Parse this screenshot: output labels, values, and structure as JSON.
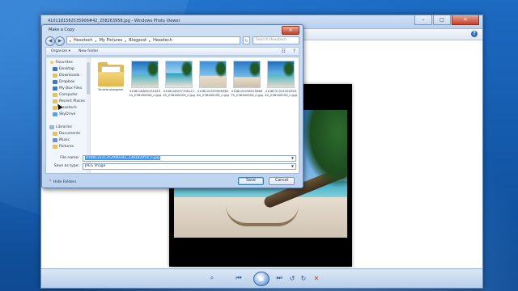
{
  "viewer": {
    "title": "4101181562535906#42_258263958.jpg - Windows Photo Viewer",
    "controls": {
      "zoom": "⌕",
      "previous": "⏮",
      "slideshow": "▣",
      "next": "⏭",
      "rotate_left": "↺",
      "rotate_right": "↻",
      "delete": "✕"
    }
  },
  "dialog": {
    "title": "Make a Copy",
    "breadcrumbs": [
      "Hexotech",
      "My Pictures",
      "Blogpost",
      "Hexotech"
    ],
    "search_placeholder": "Search Hexotech",
    "toolbar": {
      "organize": "Organize ▾",
      "new_folder": "New folder"
    },
    "nav": {
      "favorites_header": "Favorites",
      "favorites": [
        "Desktop",
        "Downloads",
        "Dropbox",
        "My Box Files",
        "Computer",
        "Recent Places",
        "Hexotech",
        "SkyDrive"
      ],
      "libraries_header": "Libraries",
      "libraries": [
        "Documents",
        "Music",
        "Pictures"
      ]
    },
    "files": [
      {
        "name": "thumb.storgram",
        "kind": "folder"
      },
      {
        "name": "410811864915181514_238182059_n.jpg",
        "kind": "image"
      },
      {
        "name": "410812803770612129_238182059_n.jpg",
        "kind": "image"
      },
      {
        "name": "410812525999996364_238182059_n.jpg",
        "kind": "image"
      },
      {
        "name": "410812525851566975_238182059_n.jpg",
        "kind": "image"
      },
      {
        "name": "410813131252090342_238182059_n.jpg",
        "kind": "image"
      }
    ],
    "file_name_label": "File name:",
    "file_name_value": "410813131252090342_238182059_n.jpg",
    "save_type_label": "Save as type:",
    "save_type_value": "JPEG Image",
    "hide_folders": "Hide Folders",
    "save_button": "Save",
    "cancel_button": "Cancel"
  }
}
